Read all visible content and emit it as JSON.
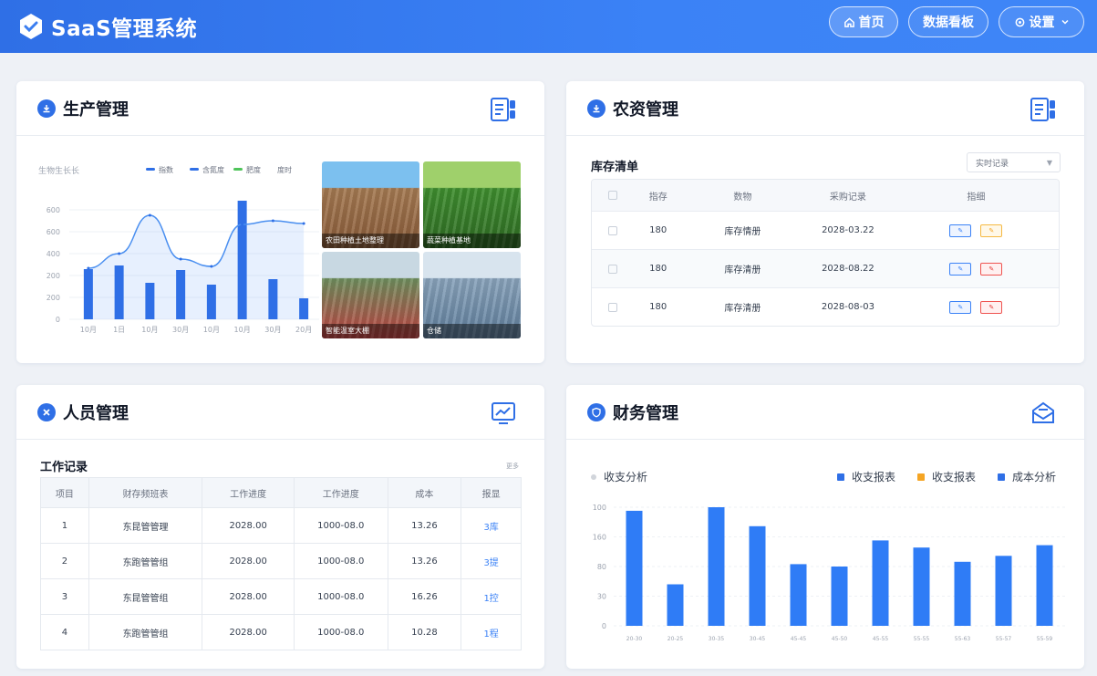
{
  "header": {
    "app_title": "SaaS管理系统",
    "nav": {
      "home": "首页",
      "dashboard": "数据看板",
      "settings": "设置"
    }
  },
  "production": {
    "title": "生产管理",
    "chart_data": {
      "type": "bar",
      "title": "生物生长长",
      "legend": [
        "指数",
        "含氮度",
        "肥度",
        "度时"
      ],
      "categories": [
        "10月",
        "1日",
        "10月",
        "30月",
        "10月",
        "10月",
        "30月",
        "20月"
      ],
      "values": [
        275,
        295,
        200,
        270,
        190,
        650,
        220,
        115
      ],
      "line_values": [
        280,
        360,
        570,
        330,
        290,
        520,
        540,
        525
      ],
      "ylim": [
        0,
        600
      ],
      "yticks": [
        "0",
        "200",
        "200",
        "400",
        "600",
        "600"
      ]
    },
    "photos": [
      {
        "caption": "农田种植土地整理",
        "colors": [
          "#7cc0ef",
          "#a57a52",
          "#8a5c3a"
        ]
      },
      {
        "caption": "蔬菜种植基地",
        "colors": [
          "#9fd06b",
          "#3f8f2f",
          "#2f6b24"
        ]
      },
      {
        "caption": "智能温室大棚",
        "colors": [
          "#c8d8e2",
          "#6f8f5e",
          "#c24444"
        ]
      },
      {
        "caption": "仓储",
        "colors": [
          "#d8e4ee",
          "#8aa4bc",
          "#5f7e9c"
        ]
      }
    ]
  },
  "inventory": {
    "title": "农资管理",
    "subtitle": "库存清单",
    "select_value": "实时记录",
    "columns": [
      "",
      "指存",
      "数物",
      "采购记录",
      "指细"
    ],
    "rows": [
      {
        "qty": "180",
        "item": "库存情册",
        "date": "2028-03.22",
        "op2": "yellow"
      },
      {
        "qty": "180",
        "item": "库存清册",
        "date": "2028-08.22",
        "op2": "red"
      },
      {
        "qty": "180",
        "item": "库存清册",
        "date": "2028-08-03",
        "op2": "red"
      }
    ]
  },
  "staff": {
    "title": "人员管理",
    "subtitle": "工作记录",
    "note": "更多",
    "columns": [
      "项目",
      "财存频班表",
      "工作进度",
      "工作进度",
      "成本",
      "报显"
    ],
    "rows": [
      {
        "no": "1",
        "name": "东昆管管理",
        "p1": "2028.00",
        "p2": "1000-08.0",
        "cost": "13.26",
        "link": "3库"
      },
      {
        "no": "2",
        "name": "东跑管管组",
        "p1": "2028.00",
        "p2": "1000-08.0",
        "cost": "13.26",
        "link": "3提"
      },
      {
        "no": "3",
        "name": "东昆管管组",
        "p1": "2028.00",
        "p2": "1000-08.0",
        "cost": "16.26",
        "link": "1控"
      },
      {
        "no": "4",
        "name": "东跑管管组",
        "p1": "2028.00",
        "p2": "1000-08.0",
        "cost": "10.28",
        "link": "1程"
      }
    ]
  },
  "finance": {
    "title": "财务管理",
    "legend_left": "收支分析",
    "legend": [
      {
        "label": "收支报表",
        "color": "#2f6fe6"
      },
      {
        "label": "收支报表",
        "color": "#f5a524"
      },
      {
        "label": "成本分析",
        "color": "#2f6fe6"
      }
    ],
    "chart_data": {
      "type": "bar",
      "categories": [
        "20-30",
        "20-25",
        "30-35",
        "30-45",
        "45-45",
        "45-50",
        "45-55",
        "55-55",
        "55-63",
        "55-57",
        "55-59"
      ],
      "values": [
        97,
        35,
        100,
        84,
        52,
        50,
        72,
        66,
        54,
        59,
        68
      ],
      "ylim": [
        0,
        100
      ],
      "yticks": [
        "0",
        "30",
        "80",
        "160",
        "100"
      ]
    }
  }
}
